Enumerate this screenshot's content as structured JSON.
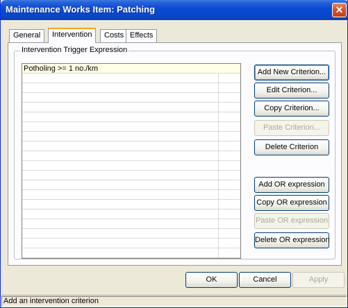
{
  "window": {
    "title": "Maintenance Works Item: Patching",
    "close_icon": "close-icon"
  },
  "tabs": [
    {
      "label": "General",
      "active": false
    },
    {
      "label": "Intervention",
      "active": true
    },
    {
      "label": "Costs",
      "active": false
    },
    {
      "label": "Effects",
      "active": false
    }
  ],
  "group": {
    "title": "Intervention Trigger Expression"
  },
  "grid": {
    "rows": [
      "Potholing >= 1 no./km"
    ]
  },
  "buttons": {
    "add_new_criterion": "Add New Criterion...",
    "edit_criterion": "Edit Criterion...",
    "copy_criterion": "Copy Criterion...",
    "paste_criterion": "Paste Criterion...",
    "delete_criterion": "Delete Criterion",
    "add_or": "Add OR expression",
    "copy_or": "Copy OR expression",
    "paste_or": "Paste OR expression",
    "delete_or": "Delete OR expression"
  },
  "dialog_buttons": {
    "ok": "OK",
    "cancel": "Cancel",
    "apply": "Apply"
  },
  "status": {
    "text": "Add an intervention criterion"
  },
  "colors": {
    "title_bar": "#0a4ad6",
    "active_tab_accent": "#f5a623",
    "selected_row": "#ffffe6"
  }
}
